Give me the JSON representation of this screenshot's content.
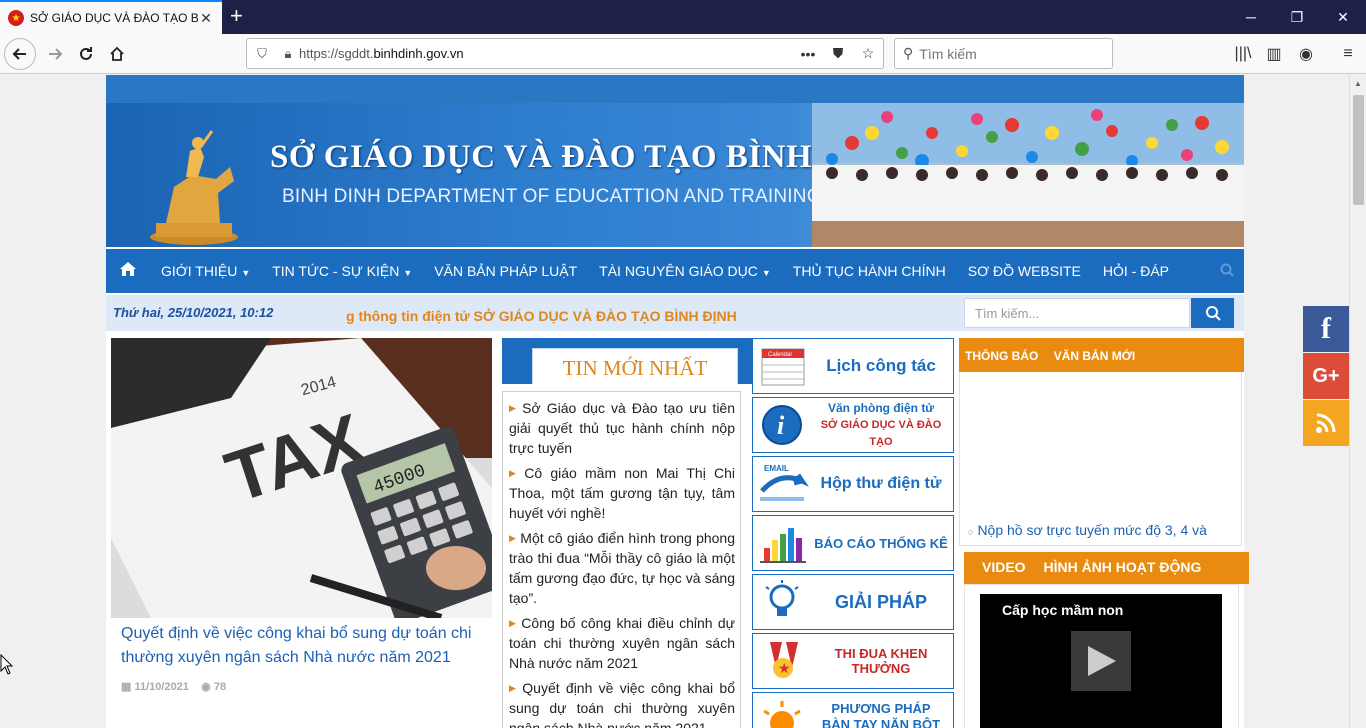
{
  "browser": {
    "tab_title": "SỞ GIÁO DỤC VÀ ĐÀO TẠO BÌNH ĐỊNH",
    "url_prefix": "https://sgddt.",
    "url_domain": "binhdinh.gov.vn",
    "search_placeholder": "Tìm kiếm"
  },
  "header": {
    "title_vi": "SỞ GIÁO DỤC VÀ ĐÀO TẠO BÌNH ĐỊNH",
    "title_en": "BINH DINH DEPARTMENT OF EDUCATTION AND TRAINING"
  },
  "menu": {
    "items": [
      {
        "label": "GIỚI THIỆU",
        "dropdown": true
      },
      {
        "label": "TIN TỨC - SỰ KIỆN",
        "dropdown": true
      },
      {
        "label": "VĂN BẢN PHÁP LUẬT",
        "dropdown": false
      },
      {
        "label": "TÀI NGUYÊN GIÁO DỤC",
        "dropdown": true
      },
      {
        "label": "THỦ TỤC HÀNH CHÍNH",
        "dropdown": false
      },
      {
        "label": "SƠ ĐỒ WEBSITE",
        "dropdown": false
      },
      {
        "label": "HỎI - ĐÁP",
        "dropdown": false
      }
    ]
  },
  "datebar": {
    "date": "Thứ hai, 25/10/2021, 10:12",
    "marquee": "g thông tin điện tử SỞ GIÁO DỤC VÀ ĐÀO TẠO BÌNH ĐỊNH",
    "search_placeholder": "Tìm kiếm..."
  },
  "featured": {
    "image_text": "TAX",
    "calc_display": "45000",
    "year": "2014",
    "title": "Quyết định về việc công khai bổ sung dự toán chi thường xuyên ngân sách Nhà nước năm 2021",
    "date": "11/10/2021",
    "views": "78"
  },
  "news": {
    "heading": "TIN MỚI NHẤT",
    "items": [
      "Sở Giáo dục và Đào tạo ưu tiên giải quyết thủ tục hành chính nộp trực tuyến",
      "Cô giáo mầm non Mai Thị Chi Thoa, một tấm gương tận tụy, tâm huyết với nghề!",
      "Một cô giáo điển hình trong phong trào thi đua “Mỗi thầy cô giáo là một tấm gương đạo đức, tự học và sáng tạo”.",
      "Công bố công khai điều chỉnh dự toán chi thường xuyên ngân sách Nhà nước năm 2021",
      "Quyết định về việc công khai bổ sung dự toán chi thường xuyên ngân sách Nhà nước năm 2021"
    ]
  },
  "links": {
    "lich": "Lịch công tác",
    "calendar_word": "Calendar",
    "vp_line1": "Văn phòng điện tử",
    "vp_line2": "SỞ GIÁO DỤC VÀ ĐÀO TẠO",
    "email_word": "EMAIL",
    "hopthu": "Hộp thư điện tử",
    "baocao": "BÁO CÁO THỐNG KÊ",
    "giaiphap": "GIẢI PHÁP",
    "thidua": "THI ĐUA KHEN THƯỞNG",
    "pp_line1": "PHƯƠNG PHÁP",
    "pp_line2": "BÀN TAY NẶN BỘT"
  },
  "notices": {
    "tab1": "THÔNG BÁO",
    "tab2": "VĂN BẢN MỚI",
    "item": "Nộp hồ sơ trực tuyến mức độ 3, 4 và"
  },
  "video": {
    "tab1": "VIDEO",
    "tab2": "HÌNH ẢNH HOẠT ĐỘNG",
    "caption": "Cấp học mầm non"
  },
  "social": {
    "facebook": "f",
    "google": "G+"
  },
  "colors": {
    "primary_blue": "#1b6cbf",
    "accent_orange": "#e98b10",
    "link_blue": "#1a61b5"
  }
}
